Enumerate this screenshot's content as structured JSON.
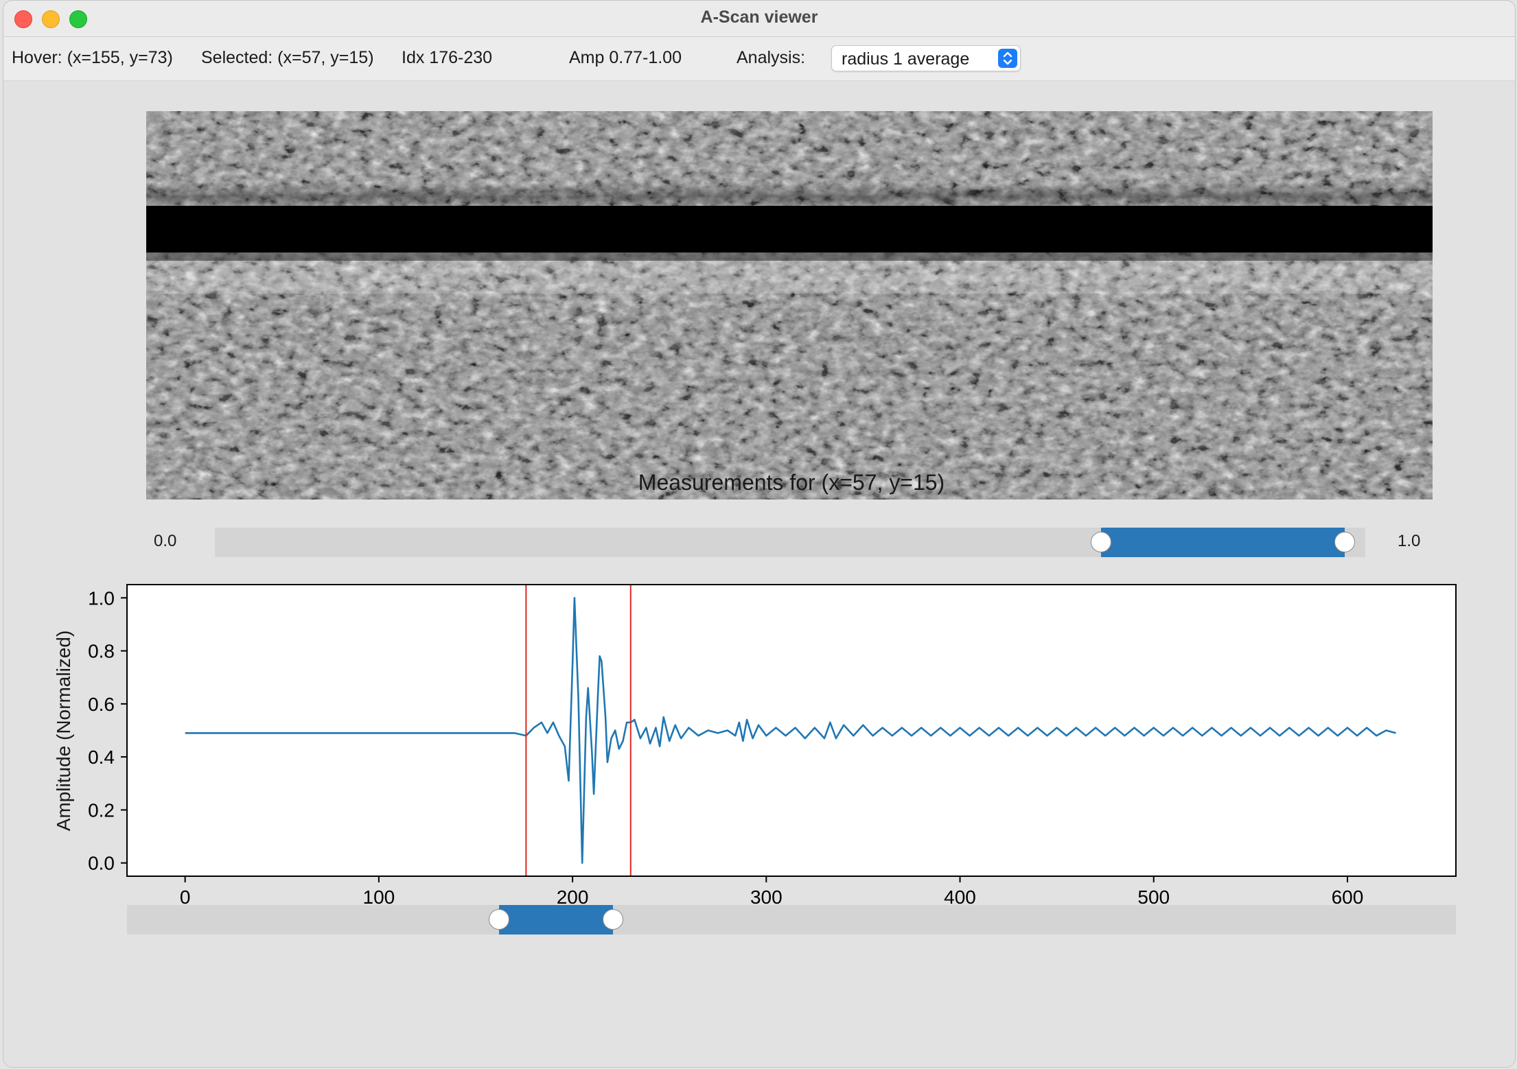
{
  "window": {
    "title": "A-Scan viewer"
  },
  "info": {
    "hover": "Hover: (x=155, y=73)",
    "selected": "Selected: (x=57, y=15)",
    "idx": "Idx 176-230",
    "amp": "Amp 0.77-1.00",
    "analysis_label": "Analysis:",
    "analysis_value": "radius 1 average"
  },
  "amp_slider": {
    "min_label": "0.0",
    "max_label": "1.0",
    "low": 0.77,
    "high": 1.0
  },
  "index_slider": {
    "low": 162,
    "high": 221,
    "min": -30,
    "max": 656
  },
  "chart_data": {
    "type": "line",
    "title": "Measurements for (x=57, y=15)",
    "xlabel": "",
    "ylabel": "Amplitude (Normalized)",
    "xlim": [
      -30,
      656
    ],
    "ylim": [
      -0.05,
      1.05
    ],
    "xticks": [
      "0",
      "100",
      "200",
      "300",
      "400",
      "500",
      "600"
    ],
    "yticks": [
      "0.0",
      "0.2",
      "0.4",
      "0.6",
      "0.8",
      "1.0"
    ],
    "vlines": [
      176,
      230
    ],
    "series": [
      {
        "color": "#1f77b4",
        "points": [
          [
            0,
            0.49
          ],
          [
            60,
            0.49
          ],
          [
            120,
            0.49
          ],
          [
            150,
            0.49
          ],
          [
            170,
            0.49
          ],
          [
            176,
            0.48
          ],
          [
            180,
            0.51
          ],
          [
            184,
            0.53
          ],
          [
            187,
            0.49
          ],
          [
            190,
            0.53
          ],
          [
            193,
            0.48
          ],
          [
            196,
            0.44
          ],
          [
            198,
            0.31
          ],
          [
            200,
            0.75
          ],
          [
            201,
            1.0
          ],
          [
            203,
            0.62
          ],
          [
            205,
            0.0
          ],
          [
            207,
            0.55
          ],
          [
            208,
            0.66
          ],
          [
            210,
            0.42
          ],
          [
            211,
            0.26
          ],
          [
            213,
            0.62
          ],
          [
            214,
            0.78
          ],
          [
            215,
            0.76
          ],
          [
            217,
            0.55
          ],
          [
            218,
            0.38
          ],
          [
            220,
            0.47
          ],
          [
            222,
            0.5
          ],
          [
            224,
            0.43
          ],
          [
            226,
            0.46
          ],
          [
            228,
            0.53
          ],
          [
            230,
            0.53
          ],
          [
            232,
            0.54
          ],
          [
            235,
            0.47
          ],
          [
            238,
            0.51
          ],
          [
            240,
            0.45
          ],
          [
            243,
            0.51
          ],
          [
            245,
            0.44
          ],
          [
            247,
            0.55
          ],
          [
            250,
            0.46
          ],
          [
            253,
            0.52
          ],
          [
            256,
            0.47
          ],
          [
            260,
            0.51
          ],
          [
            265,
            0.48
          ],
          [
            270,
            0.5
          ],
          [
            275,
            0.49
          ],
          [
            280,
            0.5
          ],
          [
            284,
            0.48
          ],
          [
            286,
            0.53
          ],
          [
            288,
            0.46
          ],
          [
            290,
            0.54
          ],
          [
            293,
            0.47
          ],
          [
            296,
            0.52
          ],
          [
            300,
            0.48
          ],
          [
            305,
            0.51
          ],
          [
            310,
            0.48
          ],
          [
            315,
            0.51
          ],
          [
            320,
            0.47
          ],
          [
            325,
            0.51
          ],
          [
            330,
            0.47
          ],
          [
            333,
            0.53
          ],
          [
            336,
            0.47
          ],
          [
            340,
            0.52
          ],
          [
            345,
            0.48
          ],
          [
            350,
            0.52
          ],
          [
            355,
            0.48
          ],
          [
            360,
            0.51
          ],
          [
            365,
            0.48
          ],
          [
            370,
            0.51
          ],
          [
            375,
            0.48
          ],
          [
            380,
            0.51
          ],
          [
            385,
            0.48
          ],
          [
            390,
            0.51
          ],
          [
            395,
            0.48
          ],
          [
            400,
            0.51
          ],
          [
            405,
            0.48
          ],
          [
            410,
            0.51
          ],
          [
            415,
            0.48
          ],
          [
            420,
            0.51
          ],
          [
            425,
            0.48
          ],
          [
            430,
            0.51
          ],
          [
            435,
            0.48
          ],
          [
            440,
            0.51
          ],
          [
            445,
            0.48
          ],
          [
            450,
            0.51
          ],
          [
            455,
            0.48
          ],
          [
            460,
            0.51
          ],
          [
            465,
            0.48
          ],
          [
            470,
            0.51
          ],
          [
            475,
            0.48
          ],
          [
            480,
            0.51
          ],
          [
            485,
            0.48
          ],
          [
            490,
            0.51
          ],
          [
            495,
            0.48
          ],
          [
            500,
            0.51
          ],
          [
            505,
            0.48
          ],
          [
            510,
            0.51
          ],
          [
            515,
            0.48
          ],
          [
            520,
            0.51
          ],
          [
            525,
            0.48
          ],
          [
            530,
            0.51
          ],
          [
            535,
            0.48
          ],
          [
            540,
            0.51
          ],
          [
            545,
            0.48
          ],
          [
            550,
            0.51
          ],
          [
            555,
            0.48
          ],
          [
            560,
            0.51
          ],
          [
            565,
            0.48
          ],
          [
            570,
            0.51
          ],
          [
            575,
            0.48
          ],
          [
            580,
            0.51
          ],
          [
            585,
            0.48
          ],
          [
            590,
            0.51
          ],
          [
            595,
            0.48
          ],
          [
            600,
            0.51
          ],
          [
            605,
            0.48
          ],
          [
            610,
            0.51
          ],
          [
            615,
            0.48
          ],
          [
            620,
            0.5
          ],
          [
            625,
            0.49
          ]
        ]
      }
    ]
  }
}
